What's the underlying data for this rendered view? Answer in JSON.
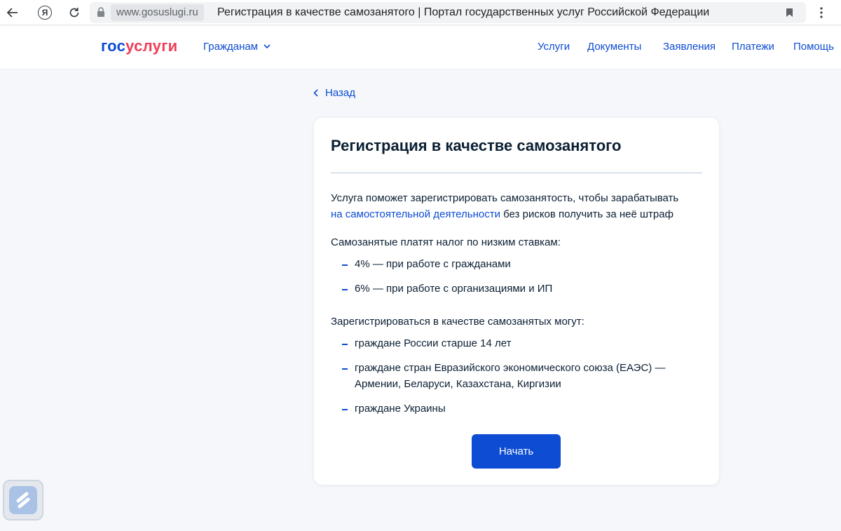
{
  "browser": {
    "domain": "www.gosuslugi.ru",
    "tab_title": "Регистрация в качестве самозанятого | Портал государственных услуг Российской Федерации",
    "ya_label": "Я"
  },
  "header": {
    "logo_part1": "гос",
    "logo_part2": "услуги",
    "audience": "Гражданам",
    "nav": [
      "Услуги",
      "Документы",
      "Заявления",
      "Платежи",
      "Помощь"
    ]
  },
  "back_label": "Назад",
  "card": {
    "title": "Регистрация в качестве самозанятого",
    "intro_line1": "Услуга поможет зарегистрировать самозанятость, чтобы зарабатывать",
    "intro_link": "на самостоятельной деятельности",
    "intro_rest": " без рисков получить за неё штраф",
    "tax_heading": "Самозанятые платят налог по низким ставкам:",
    "tax_items": [
      "4% — при работе с гражданами",
      "6% — при работе с организациями и ИП"
    ],
    "who_heading": "Зарегистрироваться в качестве самозанятых могут:",
    "who_items": [
      [
        "граждане России старше 14 лет"
      ],
      [
        "граждане стран Евразийского экономического союза (ЕАЭС) —",
        "Армении, Беларуси, Казахстана, Киргизии"
      ],
      [
        "граждане Украины"
      ]
    ],
    "start_button": "Начать"
  },
  "colors": {
    "accent": "#0d4cd3",
    "logo_red": "#ee3f58",
    "background": "#f5f7fb",
    "text": "#0b1f33"
  }
}
